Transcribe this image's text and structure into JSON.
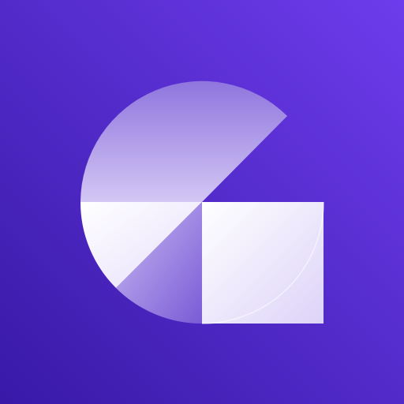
{
  "app_icon": {
    "icon": "g-logo-icon",
    "colors": {
      "background_light": "#6d3cec",
      "background_dark": "#3819a7",
      "shape_light": "#ffffff",
      "shape_dim": "#c4b3f1",
      "shape_deep": "#8f75de"
    }
  }
}
